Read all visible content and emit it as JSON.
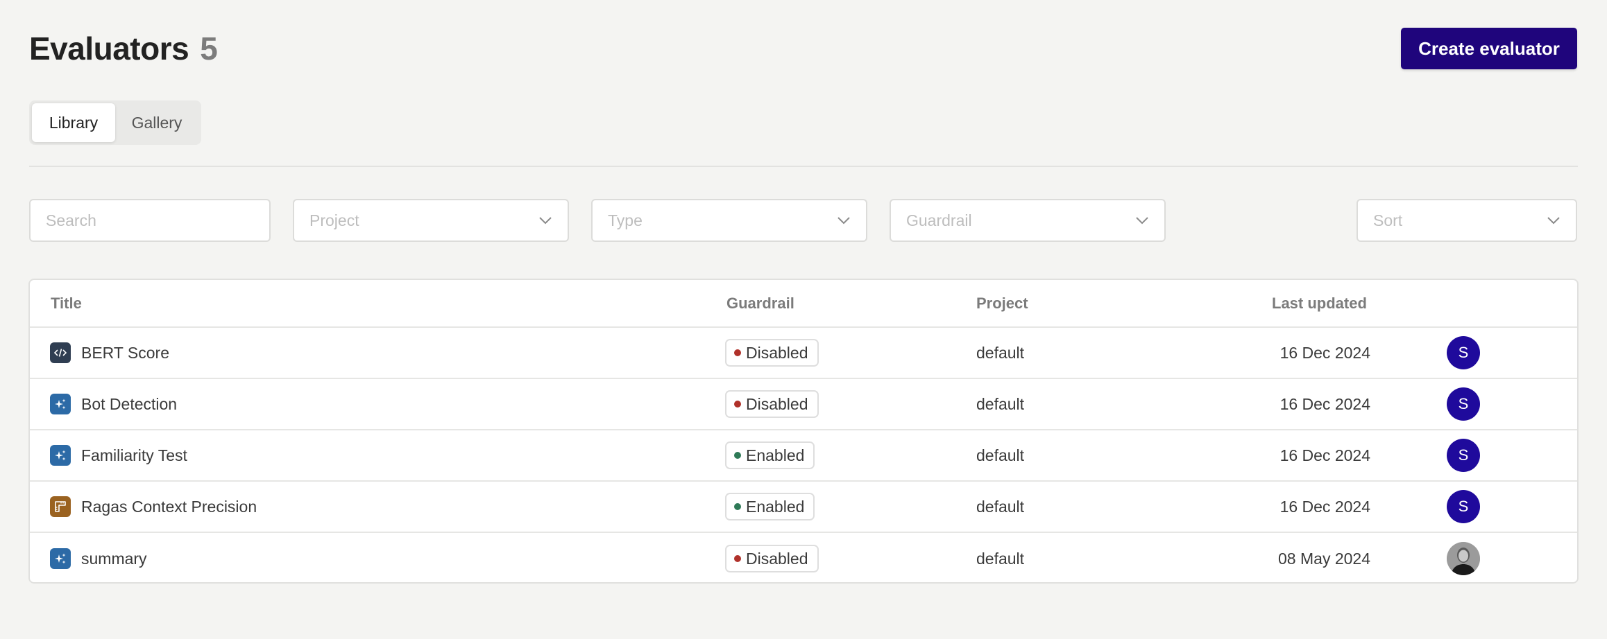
{
  "header": {
    "title": "Evaluators",
    "count": "5",
    "create_button_label": "Create evaluator"
  },
  "tabs": [
    {
      "label": "Library",
      "active": true
    },
    {
      "label": "Gallery",
      "active": false
    }
  ],
  "filters": {
    "search_placeholder": "Search",
    "project_placeholder": "Project",
    "type_placeholder": "Type",
    "guardrail_placeholder": "Guardrail",
    "sort_placeholder": "Sort"
  },
  "table": {
    "columns": [
      "Title",
      "Guardrail",
      "Project",
      "Last updated"
    ],
    "rows": [
      {
        "title": "BERT Score",
        "icon": "code-icon",
        "icon_color": "#2f3e52",
        "guardrail": "Disabled",
        "guardrail_color": "#b0312a",
        "project": "default",
        "last_updated": "16 Dec 2024",
        "avatar_initial": "S",
        "avatar_type": "initial"
      },
      {
        "title": "Bot Detection",
        "icon": "sparkles-icon",
        "icon_color": "#2c6aa6",
        "guardrail": "Disabled",
        "guardrail_color": "#b0312a",
        "project": "default",
        "last_updated": "16 Dec 2024",
        "avatar_initial": "S",
        "avatar_type": "initial"
      },
      {
        "title": "Familiarity Test",
        "icon": "sparkles-icon",
        "icon_color": "#2c6aa6",
        "guardrail": "Enabled",
        "guardrail_color": "#2e7a57",
        "project": "default",
        "last_updated": "16 Dec 2024",
        "avatar_initial": "S",
        "avatar_type": "initial"
      },
      {
        "title": "Ragas Context Precision",
        "icon": "ruler-icon",
        "icon_color": "#9a6220",
        "guardrail": "Enabled",
        "guardrail_color": "#2e7a57",
        "project": "default",
        "last_updated": "16 Dec 2024",
        "avatar_initial": "S",
        "avatar_type": "initial"
      },
      {
        "title": "summary",
        "icon": "sparkles-icon",
        "icon_color": "#2c6aa6",
        "guardrail": "Disabled",
        "guardrail_color": "#b0312a",
        "project": "default",
        "last_updated": "08 May 2024",
        "avatar_initial": "",
        "avatar_type": "photo"
      }
    ]
  },
  "colors": {
    "primary": "#1f057c",
    "avatar": "#1f0a9c",
    "background": "#f4f4f2"
  }
}
